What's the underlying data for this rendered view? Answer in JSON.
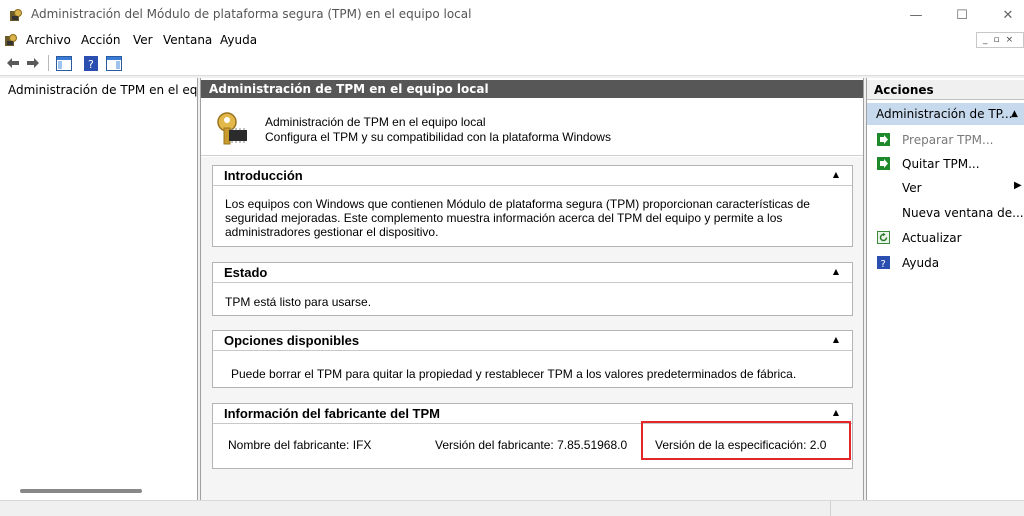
{
  "window": {
    "title": "Administración del Módulo de plataforma segura (TPM) en el equipo local",
    "min_glyph": "—",
    "max_glyph": "☐",
    "close_glyph": "✕"
  },
  "menu": {
    "items": [
      "Archivo",
      "Acción",
      "Ver",
      "Ventana",
      "Ayuda"
    ]
  },
  "toolbar": {
    "buttons": [
      "back-icon",
      "forward-icon",
      "show-hide-console-tree-icon",
      "help-icon",
      "show-hide-action-pane-icon"
    ]
  },
  "tree": {
    "item": "Administración de TPM en el equipo local"
  },
  "center": {
    "header": "Administración de TPM en el equipo local",
    "intro_line1": "Administración de TPM en el equipo local",
    "intro_line2": "Configura el TPM y su compatibilidad con la plataforma Windows",
    "sections": {
      "introduccion": {
        "title": "Introducción",
        "body": "Los equipos con Windows que contienen Módulo de plataforma segura (TPM) proporcionan características de seguridad mejoradas. Este complemento muestra información acerca del TPM del equipo y permite a los administradores gestionar el dispositivo."
      },
      "estado": {
        "title": "Estado",
        "body": "TPM está listo para usarse."
      },
      "opciones": {
        "title": "Opciones disponibles",
        "body": "Puede borrar el TPM para quitar la propiedad y restablecer TPM a los valores predeterminados de fábrica."
      },
      "fabricante": {
        "title": "Información del fabricante del TPM",
        "nombre_label": "Nombre del fabricante:",
        "nombre_value": "IFX",
        "version_label": "Versión del fabricante:",
        "version_value": "7.85.51968.0",
        "spec_label": "Versión de la especificación:",
        "spec_value": "2.0"
      }
    }
  },
  "actions": {
    "header": "Acciones",
    "group": "Administración de TP...",
    "items": [
      {
        "label": "Preparar TPM...",
        "icon": "green-arrow-icon",
        "enabled": false
      },
      {
        "label": "Quitar TPM...",
        "icon": "green-arrow-icon",
        "enabled": true
      },
      {
        "label": "Ver",
        "icon": "",
        "enabled": true
      },
      {
        "label": "Nueva ventana de...",
        "icon": "",
        "enabled": true
      },
      {
        "label": "Actualizar",
        "icon": "refresh-icon",
        "enabled": true
      },
      {
        "label": "Ayuda",
        "icon": "help-icon",
        "enabled": true
      }
    ]
  },
  "colors": {
    "header_bg": "#575757",
    "highlight_box": "#e3262a",
    "actions_selected": "#c7d9ec"
  }
}
